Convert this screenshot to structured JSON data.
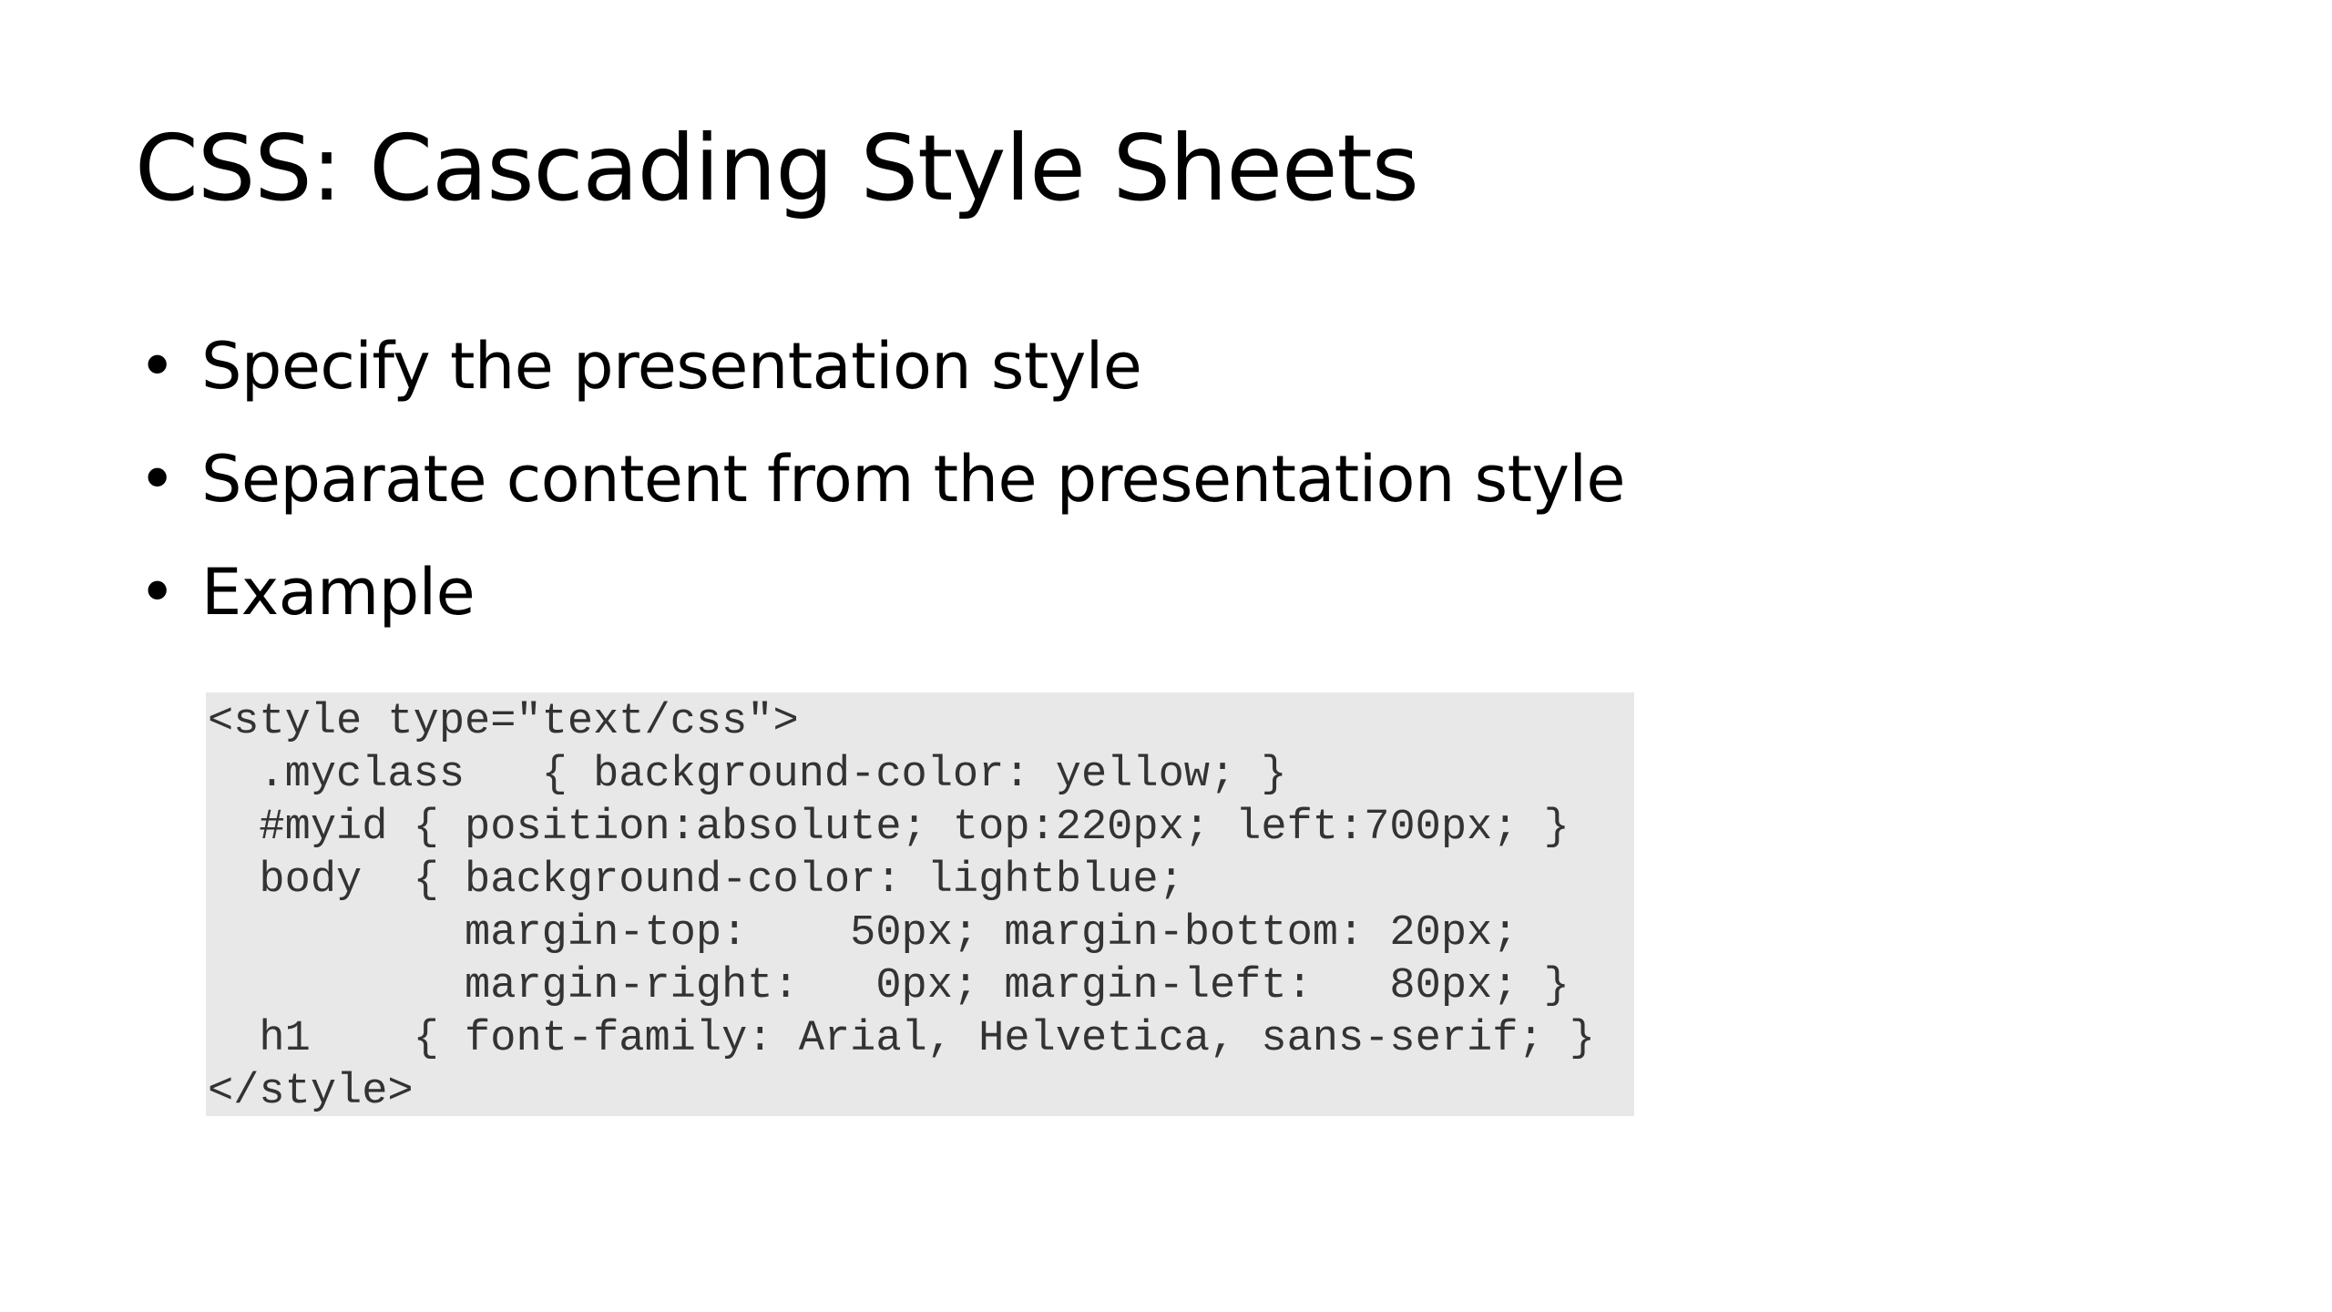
{
  "slide": {
    "title": "CSS: Cascading Style Sheets",
    "bullet_glyph": "•",
    "bullets": [
      "Specify the presentation style",
      "Separate content from the presentation style",
      "Example"
    ],
    "code_lines": [
      "<style type=\"text/css\">",
      "  .myclass   { background-color: yellow; }",
      "  #myid { position:absolute; top:220px; left:700px; }",
      "  body  { background-color: lightblue;",
      "          margin-top:    50px; margin-bottom: 20px;",
      "          margin-right:   0px; margin-left:   80px; }",
      "  h1    { font-family: Arial, Helvetica, sans-serif; }",
      "</style>"
    ]
  },
  "colors": {
    "background": "#ffffff",
    "text": "#000000",
    "code_background": "#e8e8e8",
    "code_text": "#333333"
  }
}
